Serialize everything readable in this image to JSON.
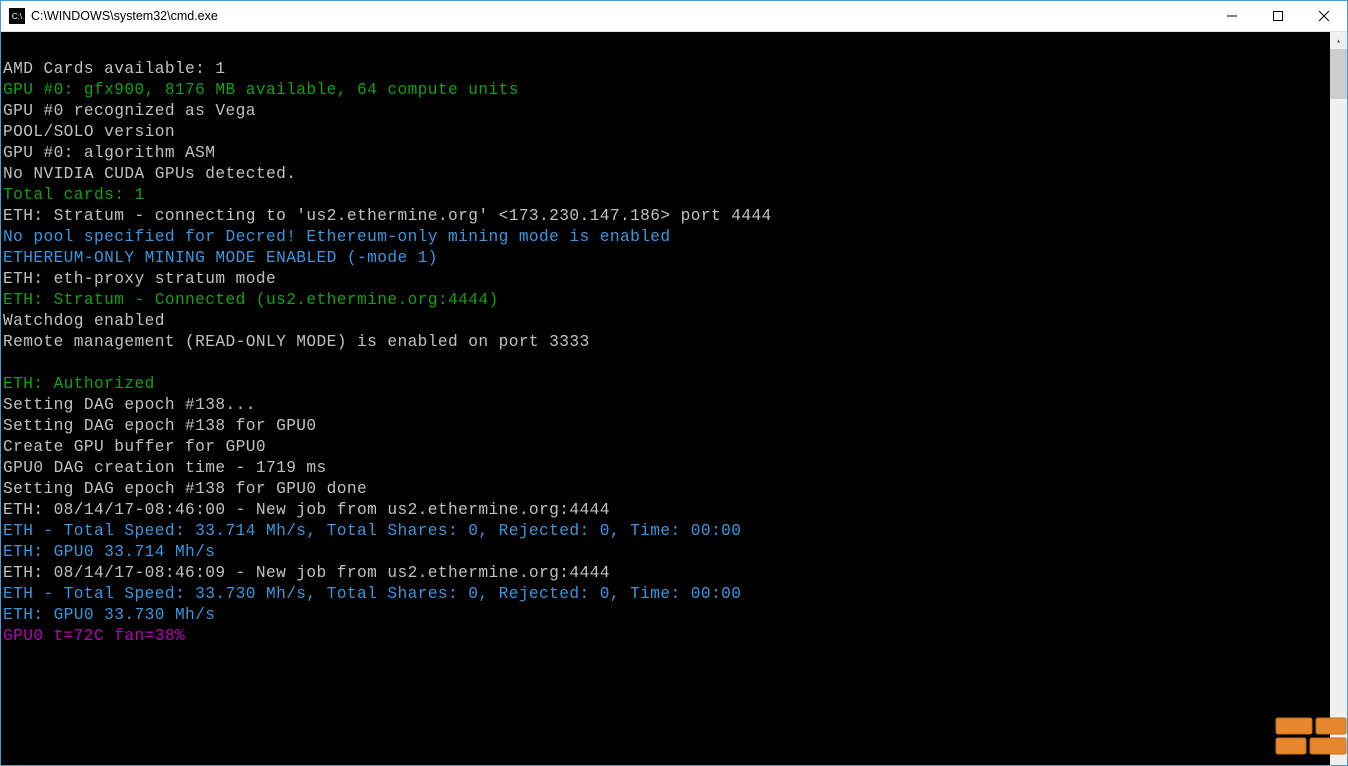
{
  "title": "C:\\WINDOWS\\system32\\cmd.exe",
  "lines": [
    {
      "color": "white",
      "text": ""
    },
    {
      "color": "white",
      "text": "AMD Cards available: 1"
    },
    {
      "color": "green",
      "text": "GPU #0: gfx900, 8176 MB available, 64 compute units"
    },
    {
      "color": "white",
      "text": "GPU #0 recognized as Vega"
    },
    {
      "color": "white",
      "text": "POOL/SOLO version"
    },
    {
      "color": "white",
      "text": "GPU #0: algorithm ASM"
    },
    {
      "color": "white",
      "text": "No NVIDIA CUDA GPUs detected."
    },
    {
      "color": "green",
      "text": "Total cards: 1"
    },
    {
      "color": "white",
      "text": "ETH: Stratum - connecting to 'us2.ethermine.org' <173.230.147.186> port 4444"
    },
    {
      "color": "cyan",
      "text": "No pool specified for Decred! Ethereum-only mining mode is enabled"
    },
    {
      "color": "cyan",
      "text": "ETHEREUM-ONLY MINING MODE ENABLED (-mode 1)"
    },
    {
      "color": "white",
      "text": "ETH: eth-proxy stratum mode"
    },
    {
      "color": "green",
      "text": "ETH: Stratum - Connected (us2.ethermine.org:4444)"
    },
    {
      "color": "white",
      "text": "Watchdog enabled"
    },
    {
      "color": "white",
      "text": "Remote management (READ-ONLY MODE) is enabled on port 3333"
    },
    {
      "color": "white",
      "text": ""
    },
    {
      "color": "green",
      "text": "ETH: Authorized"
    },
    {
      "color": "white",
      "text": "Setting DAG epoch #138..."
    },
    {
      "color": "white",
      "text": "Setting DAG epoch #138 for GPU0"
    },
    {
      "color": "white",
      "text": "Create GPU buffer for GPU0"
    },
    {
      "color": "white",
      "text": "GPU0 DAG creation time - 1719 ms"
    },
    {
      "color": "white",
      "text": "Setting DAG epoch #138 for GPU0 done"
    },
    {
      "color": "white",
      "text": "ETH: 08/14/17-08:46:00 - New job from us2.ethermine.org:4444"
    },
    {
      "color": "cyan",
      "text": "ETH - Total Speed: 33.714 Mh/s, Total Shares: 0, Rejected: 0, Time: 00:00"
    },
    {
      "color": "cyan",
      "text": "ETH: GPU0 33.714 Mh/s"
    },
    {
      "color": "white",
      "text": "ETH: 08/14/17-08:46:09 - New job from us2.ethermine.org:4444"
    },
    {
      "color": "cyan",
      "text": "ETH - Total Speed: 33.730 Mh/s, Total Shares: 0, Rejected: 0, Time: 00:00"
    },
    {
      "color": "cyan",
      "text": "ETH: GPU0 33.730 Mh/s"
    },
    {
      "color": "magenta",
      "text": "GPU0 t=72C fan=38%"
    }
  ]
}
